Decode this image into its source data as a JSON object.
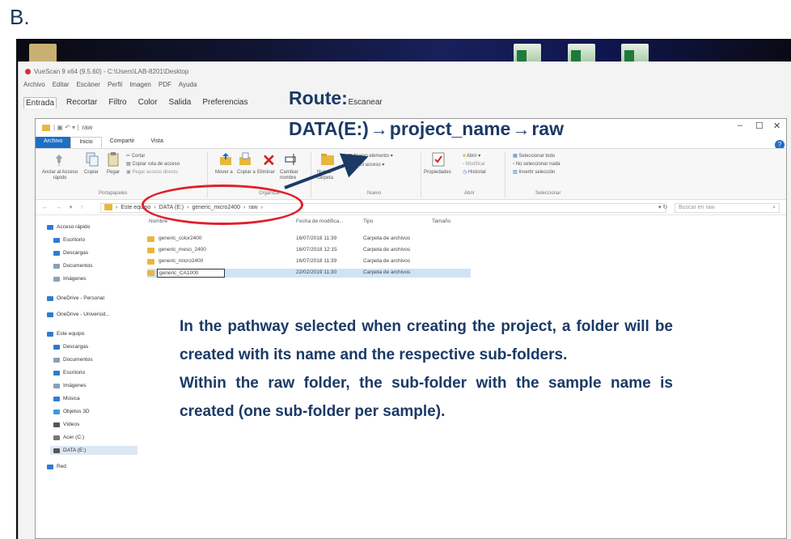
{
  "figure_label": "B.",
  "vuescan": {
    "title": "VueScan 9 x64 (9.5.60) - C:\\Users\\LAB-8201\\Desktop",
    "menu": [
      "Archivo",
      "Editar",
      "Escáner",
      "Perfil",
      "Imagen",
      "PDF",
      "Ayuda"
    ],
    "tabs": [
      "Entrada",
      "Recortar",
      "Filtro",
      "Color",
      "Salida",
      "Preferencias",
      "Escanear"
    ]
  },
  "explorer": {
    "title": "raw",
    "controls": {
      "minimize": "–",
      "maximize": "☐",
      "close": "✕",
      "help": "?"
    },
    "ribbon_tabs": [
      "Archivo",
      "Inicio",
      "Compartir",
      "Vista"
    ],
    "ribbon": {
      "pin": "Anclar al Acceso rápido",
      "copy": "Copiar",
      "paste": "Pegar",
      "cut": "Cortar",
      "copy_path": "Copiar ruta de acceso",
      "paste_shortcut": "Pegar acceso directo",
      "move": "Mover a",
      "copy_to": "Copiar a",
      "delete": "Eliminar",
      "rename": "Cambiar nombre",
      "new_folder": "Nueva carpeta",
      "new_item": "Nuevo elemento",
      "easy_access": "Fácil acceso",
      "properties": "Propiedades",
      "open": "Abrir",
      "modify": "Modificar",
      "history": "Historial",
      "select_all": "Seleccionar todo",
      "select_none": "No seleccionar nada",
      "invert_selection": "Invertir selección",
      "groups": [
        "Portapapeles",
        "Organizar",
        "Nuevo",
        "Abrir",
        "Seleccionar"
      ]
    },
    "address": {
      "nav": "← → ▾ ↑",
      "path": [
        "Este equipo",
        "DATA (E:)",
        "generic_micro2400",
        "raw"
      ],
      "refresh": "▾ ↻",
      "search_placeholder": "Buscar en raw"
    },
    "nav_pane": [
      {
        "label": "Acceso rápido",
        "color": "#2f7bd3"
      },
      {
        "label": "Escritorio",
        "color": "#2f7bd3"
      },
      {
        "label": "Descargas",
        "color": "#2f7bd3"
      },
      {
        "label": "Documentos",
        "color": "#8aa0b8"
      },
      {
        "label": "Imágenes",
        "color": "#8aa0b8"
      },
      {
        "label": "OneDrive - Personal",
        "color": "#2f7bd3"
      },
      {
        "label": "OneDrive - Universid...",
        "color": "#2f7bd3"
      },
      {
        "label": "Este equipo",
        "color": "#2f7bd3"
      },
      {
        "label": "Descargas",
        "color": "#2f7bd3"
      },
      {
        "label": "Documentos",
        "color": "#8aa0b8"
      },
      {
        "label": "Escritorio",
        "color": "#2f7bd3"
      },
      {
        "label": "Imágenes",
        "color": "#8aa0b8"
      },
      {
        "label": "Música",
        "color": "#2f7bd3"
      },
      {
        "label": "Objetos 3D",
        "color": "#3a9ad9"
      },
      {
        "label": "Vídeos",
        "color": "#555555"
      },
      {
        "label": "Acer (C:)",
        "color": "#777777"
      },
      {
        "label": "DATA (E:)",
        "color": "#555555"
      },
      {
        "label": "Red",
        "color": "#2f7bd3"
      }
    ],
    "columns": [
      "Nombre",
      "Fecha de modifica...",
      "Tipo",
      "Tamaño"
    ],
    "files": [
      {
        "name": "generic_color2400",
        "date": "16/07/2018 11:39",
        "type": "Carpeta de archivos"
      },
      {
        "name": "generic_meso_2400",
        "date": "16/07/2018 12:15",
        "type": "Carpeta de archivos"
      },
      {
        "name": "generic_micro2400",
        "date": "16/07/2018 11:39",
        "type": "Carpeta de archivos"
      },
      {
        "name": "generic_CA1000",
        "date": "22/02/2019 11:30",
        "type": "Carpeta de archivos"
      }
    ]
  },
  "annotation": {
    "route_title": "Route:",
    "route_path": [
      "DATA(E:)",
      "project_name",
      "raw"
    ],
    "route_arrow": "→",
    "note": "In the pathway selected when creating the project, a folder will be created with its name and the respective sub-folders.",
    "note2": "Within the raw folder, the sub-folder with the sample name is created (one sub-folder per sample).",
    "colors": {
      "annotation_text": "#1b3a66",
      "ellipse": "#e0202a",
      "arrow": "#1b3a66"
    }
  }
}
